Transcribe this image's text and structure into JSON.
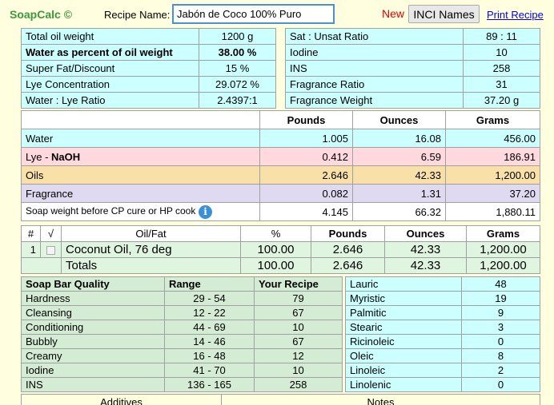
{
  "header": {
    "brand": "SoapCalc ©",
    "recipe_name_label": "Recipe Name:",
    "recipe_name_value": "Jabón de Coco 100% Puro",
    "new_label": "New",
    "inci_label": "INCI Names",
    "print_label": "Print Recipe"
  },
  "summary_left": [
    {
      "label": "Total oil weight",
      "value": "1200 g"
    },
    {
      "label": "Water as percent of oil weight",
      "value": "38.00 %"
    },
    {
      "label": "Super Fat/Discount",
      "value": "15 %"
    },
    {
      "label": "Lye Concentration",
      "value": "29.072 %"
    },
    {
      "label": "Water : Lye Ratio",
      "value": "2.4397:1"
    }
  ],
  "summary_right": [
    {
      "label": "Sat : Unsat Ratio",
      "value": "89 : 11"
    },
    {
      "label": "Iodine",
      "value": "10"
    },
    {
      "label": "INS",
      "value": "258"
    },
    {
      "label": "Fragrance Ratio",
      "value": "31"
    },
    {
      "label": "Fragrance Weight",
      "value": "37.20 g"
    }
  ],
  "weights": {
    "headers": [
      "Pounds",
      "Ounces",
      "Grams"
    ],
    "rows": [
      {
        "label": "Water",
        "pounds": "1.005",
        "ounces": "16.08",
        "grams": "456.00",
        "color": "#ccffff"
      },
      {
        "label": "Lye - ",
        "label_bold": "NaOH",
        "pounds": "0.412",
        "ounces": "6.59",
        "grams": "186.91",
        "color": "#ffd9dd"
      },
      {
        "label": "Oils",
        "pounds": "2.646",
        "ounces": "42.33",
        "grams": "1,200.00",
        "color": "#f8e0a8"
      },
      {
        "label": "Fragrance",
        "pounds": "0.082",
        "ounces": "1.31",
        "grams": "37.20",
        "color": "#e0daf0"
      },
      {
        "label": "Soap weight before CP cure or HP cook",
        "pounds": "4.145",
        "ounces": "66.32",
        "grams": "1,880.11",
        "color": "#ffffff"
      }
    ]
  },
  "oils": {
    "headers": [
      "#",
      "√",
      "Oil/Fat",
      "%",
      "Pounds",
      "Ounces",
      "Grams"
    ],
    "row": {
      "num": "1",
      "name": "Coconut Oil, 76 deg",
      "pct": "100.00",
      "pounds": "2.646",
      "ounces": "42.33",
      "grams": "1,200.00"
    },
    "totals": {
      "label": "Totals",
      "pct": "100.00",
      "pounds": "2.646",
      "ounces": "42.33",
      "grams": "1,200.00"
    }
  },
  "qualities": {
    "headers": [
      "Soap Bar Quality",
      "Range",
      "Your Recipe"
    ],
    "rows": [
      {
        "name": "Hardness",
        "range": "29 - 54",
        "value": "79"
      },
      {
        "name": "Cleansing",
        "range": "12 - 22",
        "value": "67"
      },
      {
        "name": "Conditioning",
        "range": "44 - 69",
        "value": "10"
      },
      {
        "name": "Bubbly",
        "range": "14 - 46",
        "value": "67"
      },
      {
        "name": "Creamy",
        "range": "16 - 48",
        "value": "12"
      },
      {
        "name": "Iodine",
        "range": "41 - 70",
        "value": "10"
      },
      {
        "name": "INS",
        "range": "136 - 165",
        "value": "258"
      }
    ]
  },
  "fatty_acids": [
    {
      "name": "Lauric",
      "value": "48"
    },
    {
      "name": "Myristic",
      "value": "19"
    },
    {
      "name": "Palmitic",
      "value": "9"
    },
    {
      "name": "Stearic",
      "value": "3"
    },
    {
      "name": "Ricinoleic",
      "value": "0"
    },
    {
      "name": "Oleic",
      "value": "8"
    },
    {
      "name": "Linoleic",
      "value": "2"
    },
    {
      "name": "Linolenic",
      "value": "0"
    }
  ],
  "footer": {
    "additives": "Additives",
    "notes": "Notes"
  }
}
